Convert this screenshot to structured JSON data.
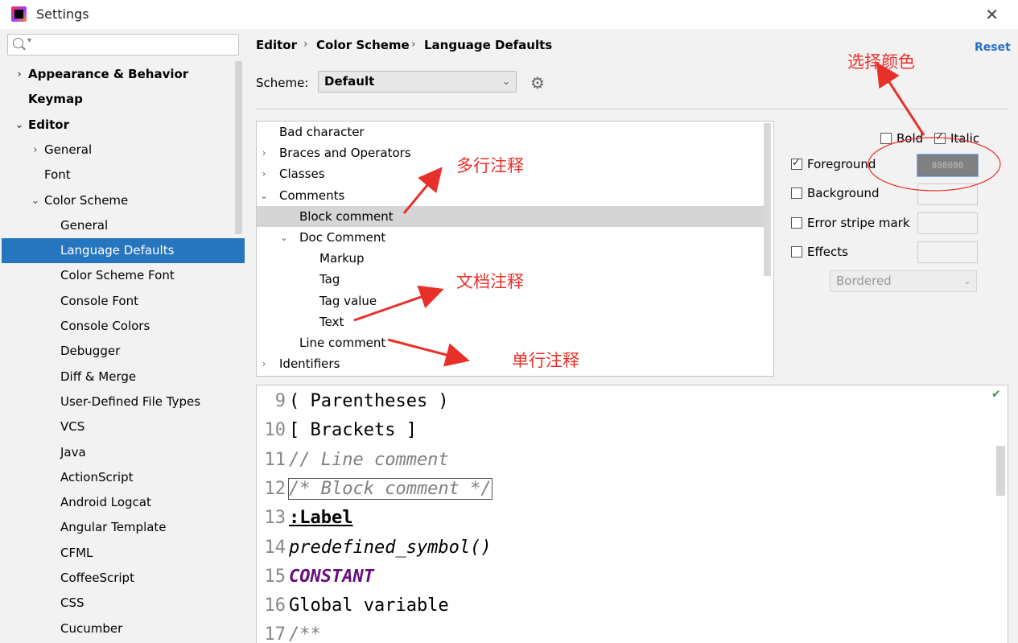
{
  "window": {
    "title": "Settings"
  },
  "sidebar": {
    "search_placeholder": "",
    "items": [
      {
        "label": "Appearance & Behavior",
        "bold": true,
        "arrow": "›",
        "indent": 0
      },
      {
        "label": "Keymap",
        "bold": true,
        "arrow": "",
        "indent": 0
      },
      {
        "label": "Editor",
        "bold": true,
        "arrow": "⌄",
        "indent": 0
      },
      {
        "label": "General",
        "bold": false,
        "arrow": "›",
        "indent": 1
      },
      {
        "label": "Font",
        "bold": false,
        "arrow": "",
        "indent": 1
      },
      {
        "label": "Color Scheme",
        "bold": false,
        "arrow": "⌄",
        "indent": 1
      },
      {
        "label": "General",
        "bold": false,
        "arrow": "",
        "indent": 2
      },
      {
        "label": "Language Defaults",
        "bold": false,
        "arrow": "",
        "indent": 2,
        "selected": true
      },
      {
        "label": "Color Scheme Font",
        "bold": false,
        "arrow": "",
        "indent": 2
      },
      {
        "label": "Console Font",
        "bold": false,
        "arrow": "",
        "indent": 2
      },
      {
        "label": "Console Colors",
        "bold": false,
        "arrow": "",
        "indent": 2
      },
      {
        "label": "Debugger",
        "bold": false,
        "arrow": "",
        "indent": 2
      },
      {
        "label": "Diff & Merge",
        "bold": false,
        "arrow": "",
        "indent": 2
      },
      {
        "label": "User-Defined File Types",
        "bold": false,
        "arrow": "",
        "indent": 2
      },
      {
        "label": "VCS",
        "bold": false,
        "arrow": "",
        "indent": 2
      },
      {
        "label": "Java",
        "bold": false,
        "arrow": "",
        "indent": 2
      },
      {
        "label": "ActionScript",
        "bold": false,
        "arrow": "",
        "indent": 2
      },
      {
        "label": "Android Logcat",
        "bold": false,
        "arrow": "",
        "indent": 2
      },
      {
        "label": "Angular Template",
        "bold": false,
        "arrow": "",
        "indent": 2
      },
      {
        "label": "CFML",
        "bold": false,
        "arrow": "",
        "indent": 2
      },
      {
        "label": "CoffeeScript",
        "bold": false,
        "arrow": "",
        "indent": 2
      },
      {
        "label": "CSS",
        "bold": false,
        "arrow": "",
        "indent": 2
      },
      {
        "label": "Cucumber",
        "bold": false,
        "arrow": "",
        "indent": 2
      }
    ]
  },
  "breadcrumb": {
    "items": [
      "Editor",
      "Color Scheme",
      "Language Defaults"
    ],
    "separator": "›"
  },
  "reset_label": "Reset",
  "scheme": {
    "label": "Scheme:",
    "value": "Default"
  },
  "element_list": [
    {
      "label": "Bad character",
      "arrow": "",
      "indent": 0
    },
    {
      "label": "Braces and Operators",
      "arrow": "›",
      "indent": 0
    },
    {
      "label": "Classes",
      "arrow": "›",
      "indent": 0
    },
    {
      "label": "Comments",
      "arrow": "⌄",
      "indent": 0
    },
    {
      "label": "Block comment",
      "arrow": "",
      "indent": 1,
      "selected": true
    },
    {
      "label": "Doc Comment",
      "arrow": "⌄",
      "indent": 1
    },
    {
      "label": "Markup",
      "arrow": "",
      "indent": 2
    },
    {
      "label": "Tag",
      "arrow": "",
      "indent": 2
    },
    {
      "label": "Tag value",
      "arrow": "",
      "indent": 2
    },
    {
      "label": "Text",
      "arrow": "",
      "indent": 2
    },
    {
      "label": "Line comment",
      "arrow": "",
      "indent": 1
    },
    {
      "label": "Identifiers",
      "arrow": "›",
      "indent": 0
    }
  ],
  "options": {
    "bold": {
      "label": "Bold",
      "checked": false
    },
    "italic": {
      "label": "Italic",
      "checked": true
    },
    "foreground": {
      "label": "Foreground",
      "checked": true,
      "color": "808080"
    },
    "background": {
      "label": "Background",
      "checked": false
    },
    "error_stripe": {
      "label": "Error stripe mark",
      "checked": false
    },
    "effects": {
      "label": "Effects",
      "checked": false
    },
    "effect_type": "Bordered"
  },
  "preview": {
    "lines": [
      {
        "num": "9",
        "code": "( Parentheses )",
        "style": ""
      },
      {
        "num": "10",
        "code": "[ Brackets ]",
        "style": ""
      },
      {
        "num": "11",
        "code": "// Line comment",
        "style": "italic-gray"
      },
      {
        "num": "12",
        "code": "/* Block comment */",
        "style": "italic-gray boxed"
      },
      {
        "num": "13",
        "code": ":Label",
        "style": "bold"
      },
      {
        "num": "14",
        "code": "predefined_symbol()",
        "style": "italic"
      },
      {
        "num": "15",
        "code": "CONSTANT",
        "style": "const"
      },
      {
        "num": "16",
        "code": "Global variable",
        "style": ""
      },
      {
        "num": "17",
        "code": "/**",
        "style": "gray"
      }
    ]
  },
  "annotations": {
    "select_color": "选择颜色",
    "multi_line": "多行注释",
    "doc_comment": "文档注释",
    "single_line": "单行注释",
    "color": "#e8302a"
  }
}
